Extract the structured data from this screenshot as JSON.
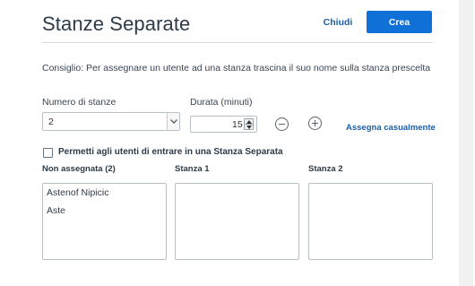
{
  "dialog": {
    "title": "Stanze Separate",
    "close_label": "Chiudi",
    "create_label": "Crea"
  },
  "hint": "Consiglio: Per assegnare un utente ad una stanza trascina il suo nome sulla stanza prescelta",
  "rooms_count": {
    "label": "Numero di stanze",
    "value": "2"
  },
  "duration": {
    "label": "Durata (minuti)",
    "value": "15"
  },
  "random_assign_label": "Assegna casualmente",
  "allow_join": {
    "label": "Permetti agli utenti di entrare in una Stanza Separata",
    "checked": false
  },
  "columns": {
    "unassigned": {
      "title": "Non assegnata (2)",
      "users": [
        "Astenof Nipicic",
        "Aste"
      ]
    },
    "room1": {
      "title": "Stanza 1",
      "users": []
    },
    "room2": {
      "title": "Stanza 2",
      "users": []
    }
  },
  "colors": {
    "primary": "#0f70d7",
    "link": "#1b5fa8",
    "title": "#2d3b48"
  },
  "icons": {
    "select_arrow": "chevron-down-icon",
    "stepper": "spinner-arrows-icon",
    "minus": "minus-circle-icon",
    "plus": "plus-circle-icon"
  }
}
